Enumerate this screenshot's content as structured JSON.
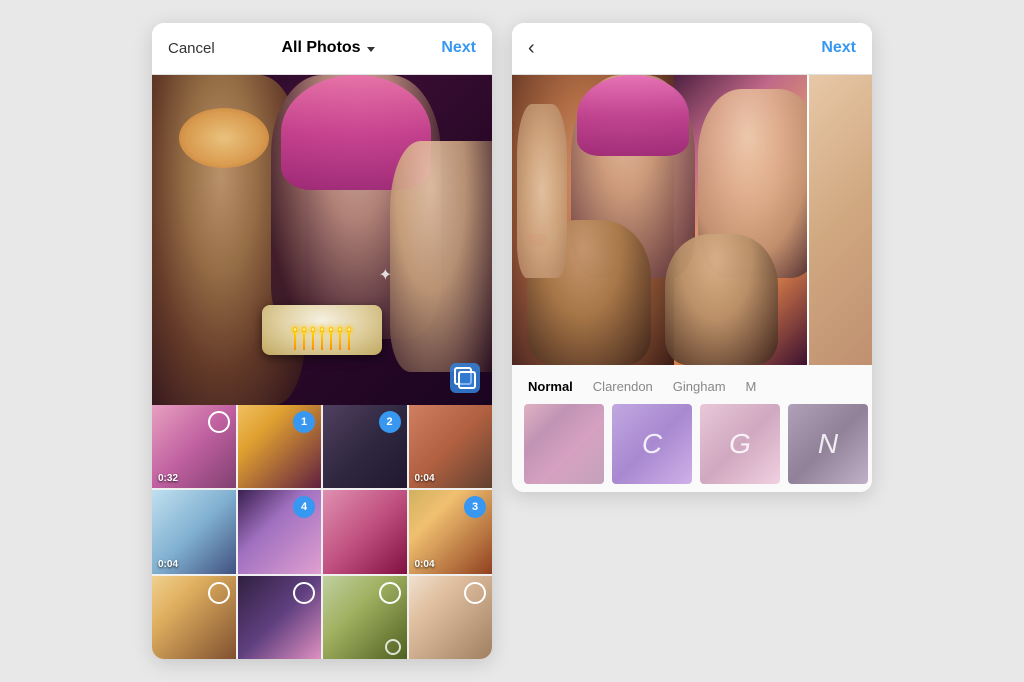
{
  "left_phone": {
    "header": {
      "cancel_label": "Cancel",
      "title": "All Photos",
      "next_label": "Next"
    },
    "thumbnails": [
      {
        "id": 1,
        "badge": null,
        "circle": true,
        "duration": "0:32",
        "has_clock": false
      },
      {
        "id": 2,
        "badge": "1",
        "circle": false,
        "duration": null,
        "has_clock": false
      },
      {
        "id": 3,
        "badge": "2",
        "circle": false,
        "duration": null,
        "has_clock": false
      },
      {
        "id": 4,
        "badge": null,
        "circle": false,
        "duration": "0:04",
        "has_clock": false
      },
      {
        "id": 5,
        "badge": null,
        "circle": false,
        "duration": "0:04",
        "has_clock": false
      },
      {
        "id": 6,
        "badge": "4",
        "circle": false,
        "duration": null,
        "has_clock": false
      },
      {
        "id": 7,
        "badge": null,
        "circle": false,
        "duration": null,
        "has_clock": false
      },
      {
        "id": 8,
        "badge": "3",
        "circle": false,
        "duration": "0:04",
        "has_clock": false
      },
      {
        "id": 9,
        "badge": null,
        "circle": true,
        "duration": null,
        "has_clock": false
      },
      {
        "id": 10,
        "badge": null,
        "circle": false,
        "duration": null,
        "has_clock": false
      },
      {
        "id": 11,
        "badge": null,
        "circle": true,
        "duration": null,
        "has_clock": true
      },
      {
        "id": 12,
        "badge": null,
        "circle": true,
        "duration": null,
        "has_clock": false
      }
    ]
  },
  "right_phone": {
    "header": {
      "back_label": "‹",
      "next_label": "Next"
    },
    "filters": [
      {
        "id": "normal",
        "label": "Normal",
        "active": true,
        "letter": ""
      },
      {
        "id": "clarendon",
        "label": "Clarendon",
        "active": false,
        "letter": "C"
      },
      {
        "id": "gingham",
        "label": "Gingham",
        "active": false,
        "letter": "G"
      },
      {
        "id": "moon",
        "label": "M",
        "active": false,
        "letter": "N"
      }
    ]
  }
}
